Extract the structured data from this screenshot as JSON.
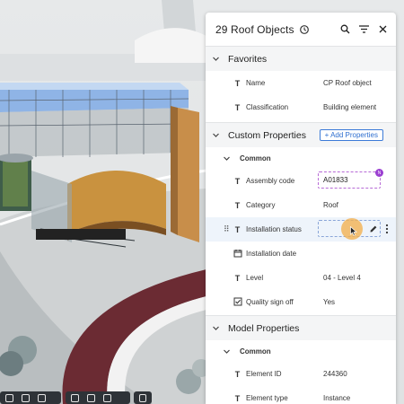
{
  "panel": {
    "count": "29",
    "title": "Roof Objects",
    "icons": [
      "history-icon",
      "search-icon",
      "filter-icon",
      "close-icon"
    ]
  },
  "favorites": {
    "title": "Favorites",
    "rows": [
      {
        "label": "Name",
        "value": "CP Roof object",
        "icon": "text-type-icon"
      },
      {
        "label": "Classification",
        "value": "Building element",
        "icon": "text-type-icon"
      }
    ]
  },
  "custom": {
    "title": "Custom Properties",
    "add_label": "+ Add Properties",
    "group": "Common",
    "rows": [
      {
        "label": "Assembly code",
        "value": "A01833",
        "icon": "text-type-icon",
        "badge": "N"
      },
      {
        "label": "Category",
        "value": "Roof",
        "icon": "text-type-icon"
      },
      {
        "label": "Installation status",
        "value": "",
        "icon": "text-type-icon"
      },
      {
        "label": "Installation date",
        "value": "",
        "icon": "calendar-icon"
      },
      {
        "label": "Level",
        "value": "04 - Level 4",
        "icon": "text-type-icon"
      },
      {
        "label": "Quality sign off",
        "value": "Yes",
        "icon": "checkbox-icon"
      }
    ]
  },
  "model": {
    "title": "Model Properties",
    "group": "Common",
    "rows": [
      {
        "label": "Element ID",
        "value": "244360",
        "icon": "text-type-icon"
      },
      {
        "label": "Element type",
        "value": "Instance",
        "icon": "text-type-icon"
      }
    ]
  },
  "colors": {
    "accent": "#2f6fd0",
    "badge": "#9b3fd1",
    "cursor_highlight": "#f3b152"
  }
}
